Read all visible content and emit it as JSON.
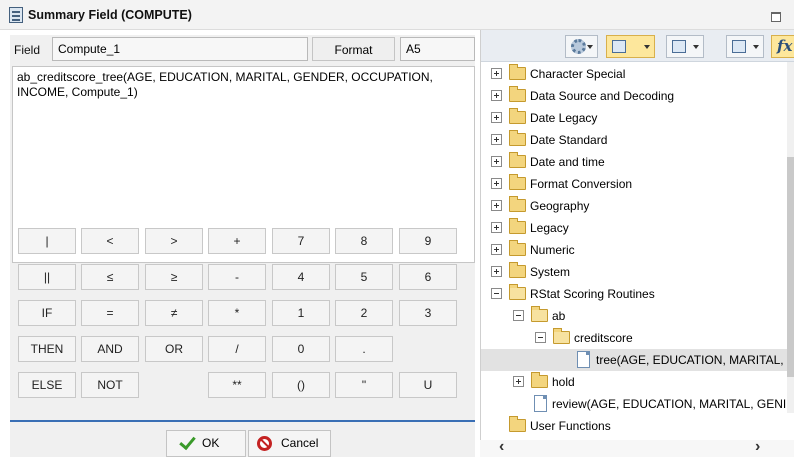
{
  "window": {
    "title": "Summary Field (COMPUTE)"
  },
  "form": {
    "field_label": "Field",
    "field_value": "Compute_1",
    "format_button": "Format",
    "format_value": "A5",
    "expression": "ab_creditscore_tree(AGE, EDUCATION, MARITAL, GENDER, OCCUPATION,\nINCOME, Compute_1)"
  },
  "keypad": {
    "keys": [
      "|",
      "<",
      ">",
      "+",
      "7",
      "8",
      "9",
      "||",
      "≤",
      "≥",
      "-",
      "4",
      "5",
      "6",
      "IF",
      "=",
      "≠",
      "*",
      "1",
      "2",
      "3",
      "THEN",
      "AND",
      "OR",
      "/",
      "0",
      ".",
      "",
      "ELSE",
      "NOT",
      "",
      "**",
      "()",
      "\"",
      "U"
    ]
  },
  "buttons": {
    "ok": "OK",
    "cancel": "Cancel"
  },
  "toolbar": {
    "icons": [
      "gear-icon",
      "view-icon",
      "list-icon",
      "tree-icon",
      "function-icon"
    ],
    "function_glyph": "fx"
  },
  "tree": {
    "items": [
      {
        "label": "Character Special",
        "toggle": "plus",
        "icon": "folder",
        "level": 0
      },
      {
        "label": "Data Source and Decoding",
        "toggle": "plus",
        "icon": "folder",
        "level": 0
      },
      {
        "label": "Date Legacy",
        "toggle": "plus",
        "icon": "folder",
        "level": 0
      },
      {
        "label": "Date Standard",
        "toggle": "plus",
        "icon": "folder",
        "level": 0
      },
      {
        "label": "Date and time",
        "toggle": "plus",
        "icon": "folder",
        "level": 0
      },
      {
        "label": "Format Conversion",
        "toggle": "plus",
        "icon": "folder",
        "level": 0
      },
      {
        "label": "Geography",
        "toggle": "plus",
        "icon": "folder",
        "level": 0
      },
      {
        "label": "Legacy",
        "toggle": "plus",
        "icon": "folder",
        "level": 0
      },
      {
        "label": "Numeric",
        "toggle": "plus",
        "icon": "folder",
        "level": 0
      },
      {
        "label": "System",
        "toggle": "plus",
        "icon": "folder",
        "level": 0
      },
      {
        "label": "RStat Scoring Routines",
        "toggle": "minus",
        "icon": "folder-open",
        "level": 0
      },
      {
        "label": "ab",
        "toggle": "minus",
        "icon": "folder-open",
        "level": 1
      },
      {
        "label": "creditscore",
        "toggle": "minus",
        "icon": "folder-open",
        "level": 2
      },
      {
        "label": "tree(AGE, EDUCATION, MARITAL,",
        "toggle": "none",
        "icon": "document",
        "level": 3,
        "selected": true
      },
      {
        "label": "hold",
        "toggle": "plus",
        "icon": "folder",
        "level": 1
      },
      {
        "label": "review(AGE, EDUCATION, MARITAL, GENI",
        "toggle": "none",
        "icon": "document",
        "level": 1.5
      },
      {
        "label": "User Functions",
        "toggle": "none",
        "icon": "folder",
        "level": 0.5
      }
    ]
  }
}
